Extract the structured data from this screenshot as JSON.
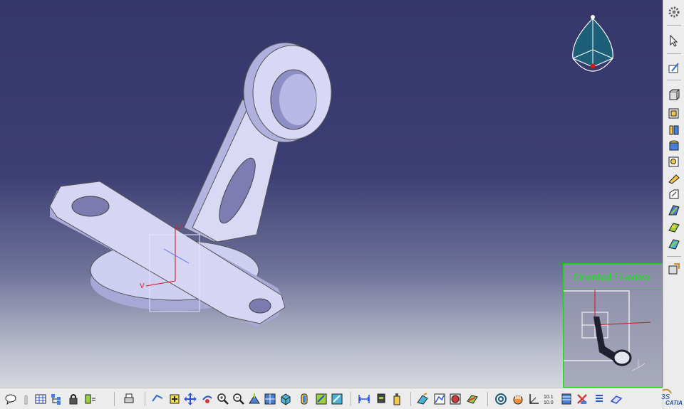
{
  "app": {
    "name": "CATIA"
  },
  "viewport": {
    "background_top": "#35366a",
    "background_bottom": "#d6d7df",
    "part_color": "#c9c9ee",
    "axis_labels": {
      "u": "U",
      "v": "V"
    }
  },
  "compass": {
    "label": "3D compass"
  },
  "preview": {
    "title": "Oriented Preview:",
    "border_color": "#1fd01f",
    "title_color": "#19e619"
  },
  "right_toolbar": {
    "icons": [
      "gear-icon",
      "select-arrow-icon",
      "sketch-icon",
      "pad-icon",
      "pocket-icon",
      "shaft-icon",
      "hole-icon",
      "rib-icon",
      "fillet-icon",
      "chamfer-icon",
      "draft-icon",
      "shell-icon",
      "thickness-icon",
      "measure-icon"
    ]
  },
  "bottom_toolbar": {
    "icons": [
      "speech-icon",
      "hand-icon",
      "table-icon",
      "tree-icon",
      "lock-icon",
      "formula-icon",
      "print-icon",
      "fly-icon",
      "fit-all-icon",
      "pan-icon",
      "rotate-icon",
      "zoom-in-icon",
      "zoom-out-icon",
      "normal-view-icon",
      "multi-view-icon",
      "iso-view-icon",
      "render-style-icon",
      "hide-show-icon",
      "swap-icon",
      "distance-icon",
      "catalog-icon",
      "bottle-icon",
      "sketch-analysis-icon",
      "map-icon",
      "apply-material-icon",
      "texture-icon",
      "spiral-icon",
      "hand-tool-icon",
      "coordinate-icon",
      "units-icon",
      "stack-icon",
      "color-icon",
      "list-icon",
      "plane-icon"
    ]
  }
}
